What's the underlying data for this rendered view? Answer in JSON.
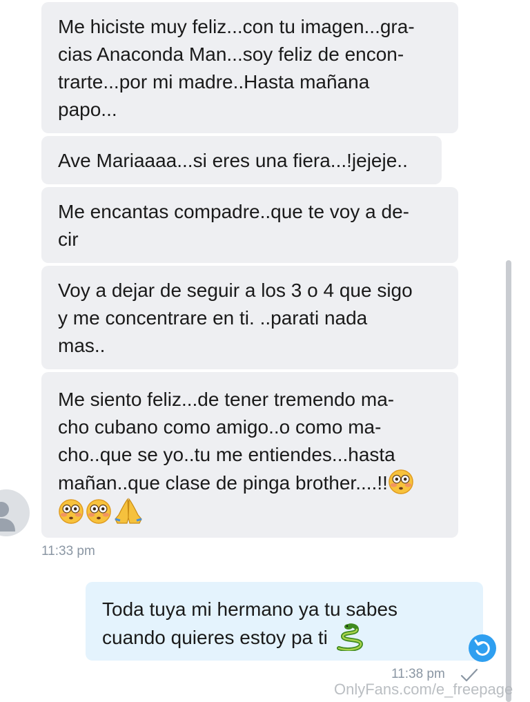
{
  "messages": [
    {
      "direction": "incoming",
      "lines": [
        "Me hiciste muy feliz...con tu imagen...gra-",
        "cias Anaconda Man...soy feliz de encon-",
        "trarte...por mi madre..Hasta mañana",
        "papo..."
      ]
    },
    {
      "direction": "incoming",
      "lines": [
        "Ave Mariaaaa...si eres una fiera...!jejeje.."
      ]
    },
    {
      "direction": "incoming",
      "lines": [
        "Me encantas compadre..que te voy a de-",
        "cir"
      ]
    },
    {
      "direction": "incoming",
      "lines": [
        "Voy a dejar de seguir a los 3 o 4 que sigo",
        "y me concentrare en ti. ..parati nada",
        "mas.."
      ]
    },
    {
      "direction": "incoming",
      "lines": [
        "Me siento feliz...de tener tremendo ma-",
        "cho cubano como amigo..o como ma-",
        "cho..que se yo..tu me entiendes...hasta",
        "mañan..que clase de pinga brother....!!"
      ],
      "emojis": [
        "flushed-face",
        "flushed-face",
        "flushed-face",
        "folded-hands"
      ]
    },
    {
      "direction": "outgoing",
      "lines": [
        "Toda tuya mi hermano ya tu sabes",
        "cuando quieres estoy pa ti"
      ],
      "emojis": [
        "snake"
      ]
    }
  ],
  "timestamps": {
    "incoming": "11:33 pm",
    "outgoing": "11:38 pm"
  },
  "watermark": "OnlyFans.com/e_freepage",
  "colors": {
    "incoming_bubble": "#eeeff2",
    "outgoing_bubble": "#e4f3fd",
    "timestamp": "#8a96a3",
    "accent": "#2f9ff0"
  },
  "icons": [
    "default-avatar-icon",
    "sent-check-icon",
    "undo-icon",
    "flushed-face-emoji",
    "folded-hands-emoji",
    "snake-emoji"
  ]
}
